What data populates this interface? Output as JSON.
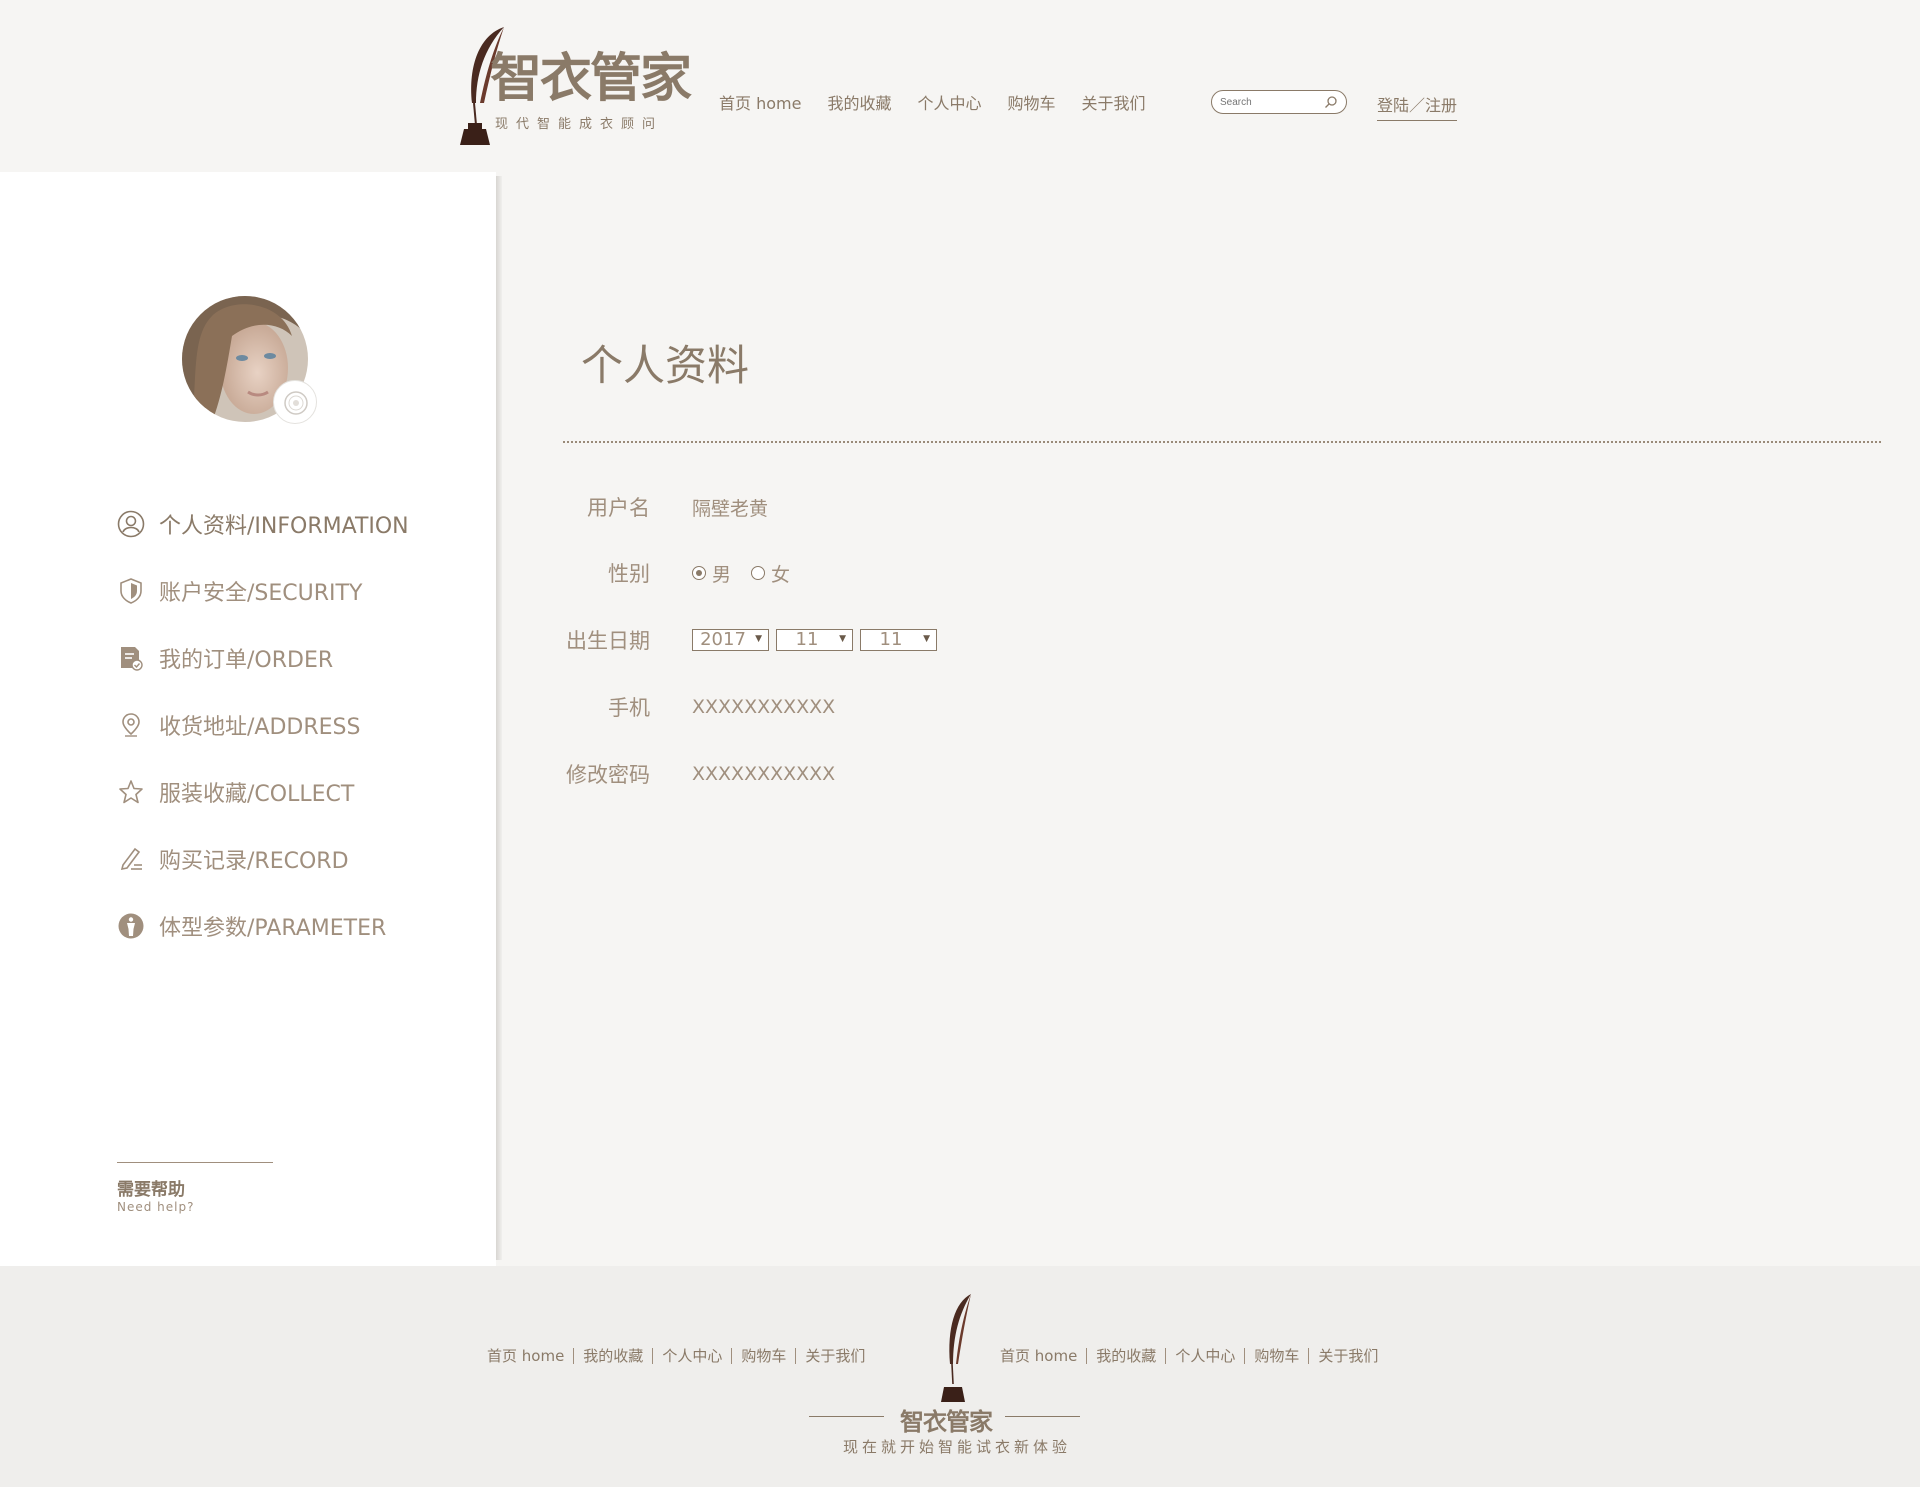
{
  "colors": {
    "accent": "#8a7a68",
    "text_light": "#a08f7e",
    "ink": "#4a2a20",
    "bg": "#f6f5f3",
    "sidebar_bg": "#ffffff"
  },
  "header": {
    "brand": "智衣管家",
    "slogan": "现代智能成衣顾问",
    "nav": [
      "首页 home",
      "我的收藏",
      "个人中心",
      "购物车",
      "关于我们"
    ],
    "search_placeholder": "Search",
    "login": "登陆／注册"
  },
  "sidebar": {
    "menu": [
      {
        "label": "个人资料/INFORMATION",
        "icon": "user-circle-icon",
        "active": true
      },
      {
        "label": "账户安全/SECURITY",
        "icon": "shield-icon",
        "active": false
      },
      {
        "label": "我的订单/ORDER",
        "icon": "order-document-icon",
        "active": false
      },
      {
        "label": "收货地址/ADDRESS",
        "icon": "location-pin-icon",
        "active": false
      },
      {
        "label": "服装收藏/COLLECT",
        "icon": "star-icon",
        "active": false
      },
      {
        "label": "购买记录/RECORD",
        "icon": "pen-record-icon",
        "active": false
      },
      {
        "label": "体型参数/PARAMETER",
        "icon": "body-figure-icon",
        "active": false
      }
    ],
    "help_cn": "需要帮助",
    "help_en": "Need help?"
  },
  "main": {
    "title": "个人资料",
    "username_label": "用户名",
    "username": "隔壁老黄",
    "gender_label": "性别",
    "gender_options": [
      "男",
      "女"
    ],
    "gender_selected": "男",
    "birthday_label": "出生日期",
    "birthday_year": "2017",
    "birthday_month": "11",
    "birthday_day": "11",
    "phone_label": "手机",
    "phone": "XXXXXXXXXXX",
    "password_label": "修改密码",
    "password": "XXXXXXXXXXX"
  },
  "footer": {
    "nav_left": [
      "首页 home",
      "我的收藏",
      "个人中心",
      "购物车",
      "关于我们"
    ],
    "nav_right": [
      "首页 home",
      "我的收藏",
      "个人中心",
      "购物车",
      "关于我们"
    ],
    "brand": "智衣管家",
    "slogan": "现在就开始智能试衣新体验"
  }
}
